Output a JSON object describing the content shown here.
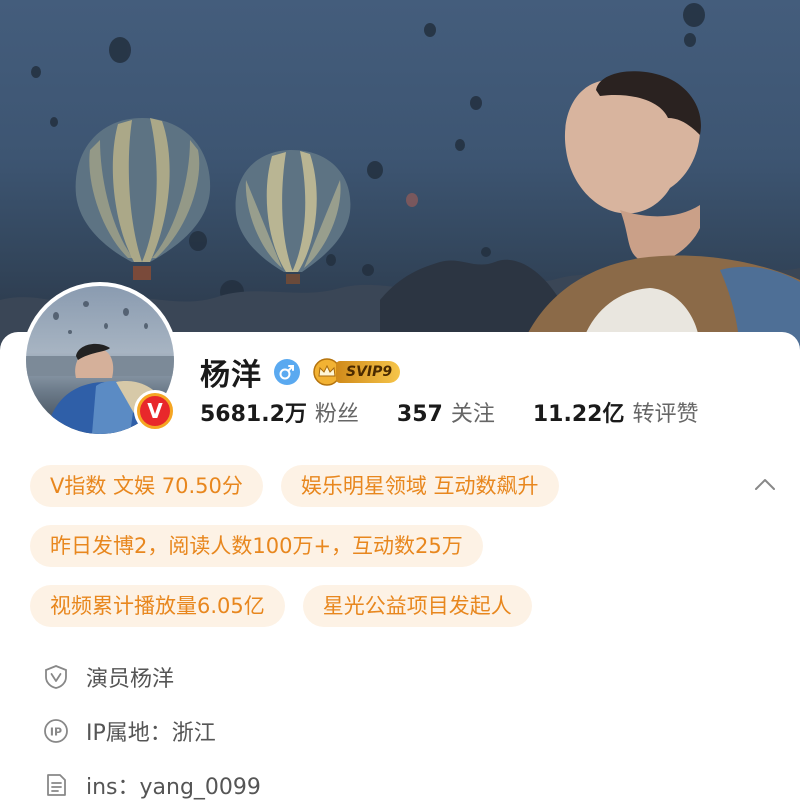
{
  "profile": {
    "name": "杨洋",
    "svip_label": "SVIP9",
    "verified_badge": "V"
  },
  "stats": [
    {
      "value": "5681.2万",
      "label": "粉丝"
    },
    {
      "value": "357",
      "label": "关注"
    },
    {
      "value": "11.22亿",
      "label": "转评赞"
    }
  ],
  "tags": [
    [
      "V指数 文娱 70.50分",
      "娱乐明星领域 互动数飙升"
    ],
    [
      "昨日发博2，阅读人数100万+，互动数25万"
    ],
    [
      "视频累计播放量6.05亿",
      "星光公益项目发起人"
    ]
  ],
  "info": [
    {
      "icon": "verified-shield-icon",
      "text": "演员杨洋"
    },
    {
      "icon": "ip-location-icon",
      "text": "IP属地：浙江"
    },
    {
      "icon": "document-icon",
      "text": "ins：yang_0099"
    }
  ],
  "colors": {
    "tag_bg": "#fdf2e5",
    "tag_text": "#e8871e",
    "gender_blue": "#5aa9f0",
    "v_badge_red": "#e8282b",
    "v_badge_ring": "#f5a623"
  }
}
